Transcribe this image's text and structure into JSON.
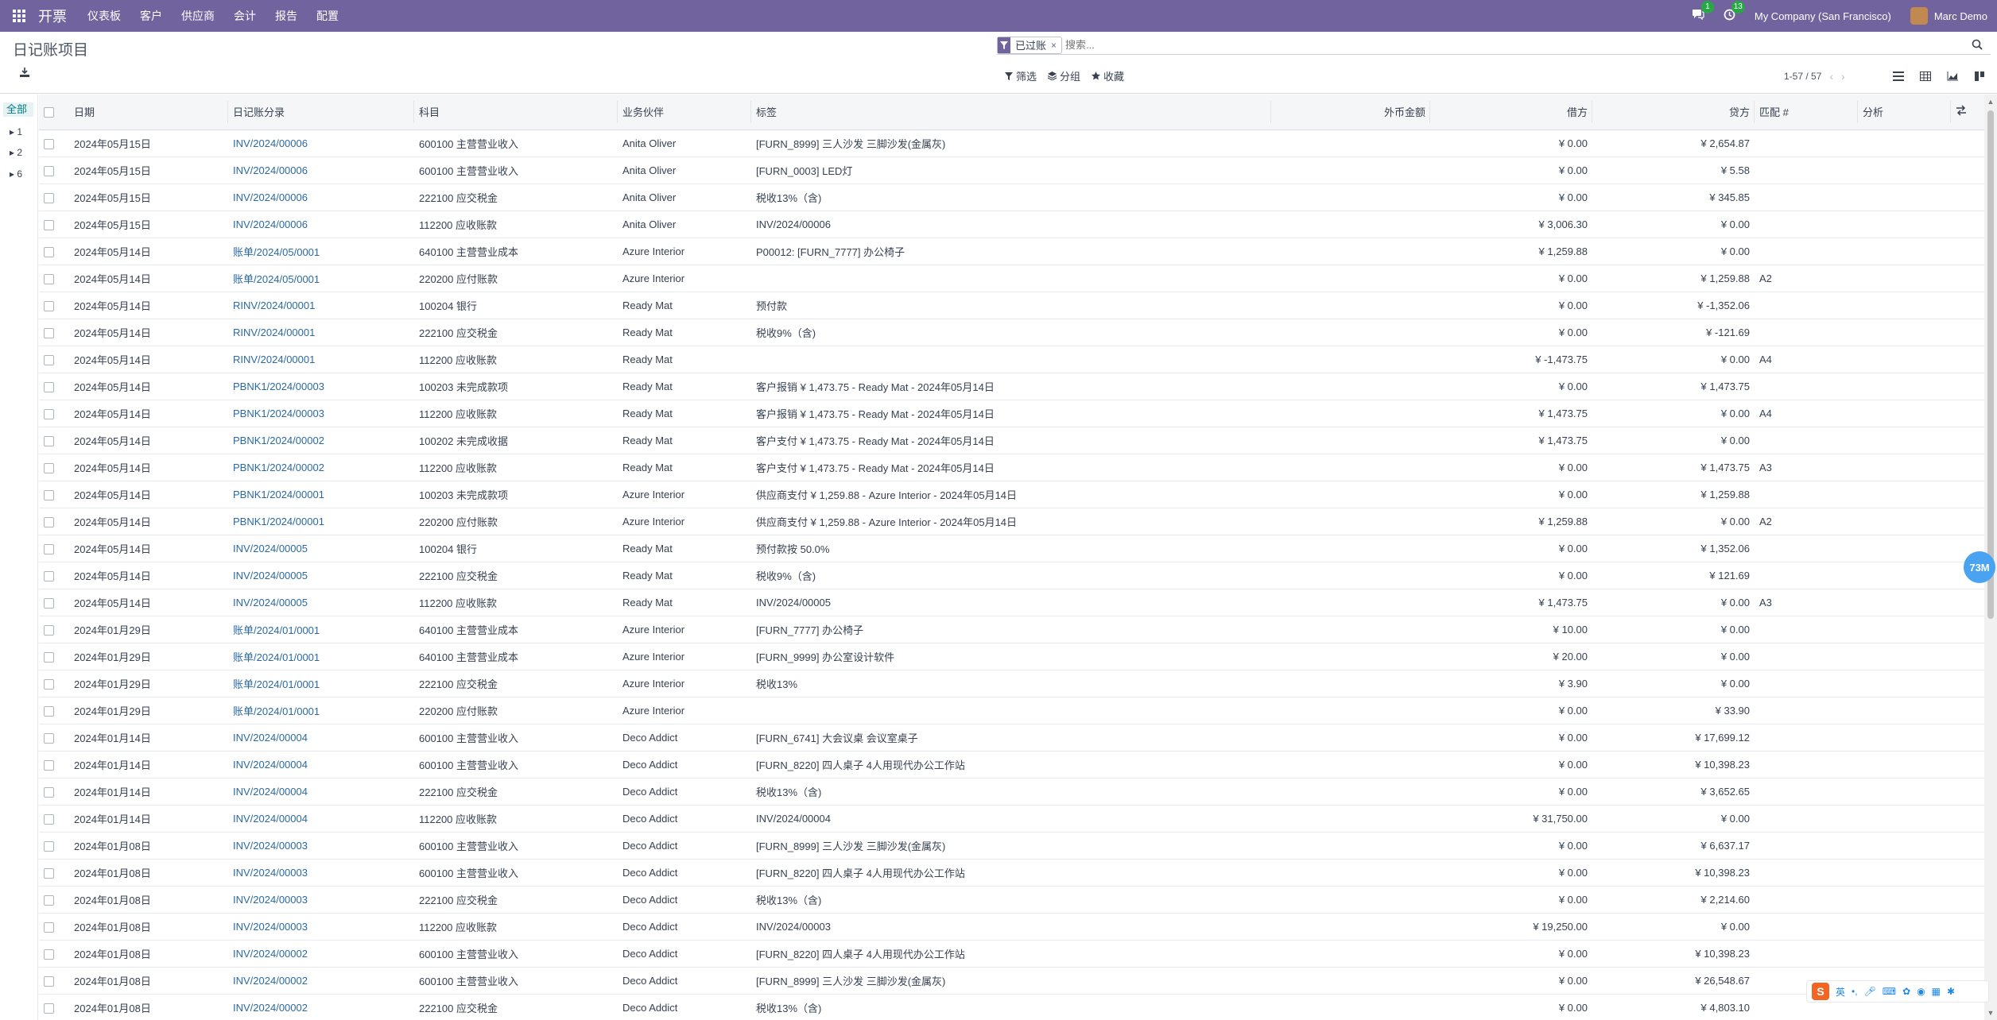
{
  "nav": {
    "app_name": "开票",
    "menus": [
      "仪表板",
      "客户",
      "供应商",
      "会计",
      "报告",
      "配置"
    ],
    "messages_badge": "1",
    "activity_badge": "13",
    "company": "My Company (San Francisco)",
    "user": "Marc Demo"
  },
  "control": {
    "title": "日记账项目",
    "facet_label": "已过账",
    "search_placeholder": "搜索...",
    "filter_label": "筛选",
    "group_label": "分组",
    "fav_label": "收藏",
    "pager": "1-57 / 57"
  },
  "side": {
    "all": "全部",
    "nodes": [
      "1",
      "2",
      "6"
    ]
  },
  "columns": {
    "date": "日期",
    "move": "日记账分录",
    "account": "科目",
    "partner": "业务伙伴",
    "label": "标签",
    "currency": "外币金额",
    "debit": "借方",
    "credit": "贷方",
    "matching": "匹配 #",
    "analytic": "分析"
  },
  "rows": [
    {
      "date": "2024年05月15日",
      "move": "INV/2024/00006",
      "account": "600100 主营营业收入",
      "partner": "Anita Oliver",
      "label": "[FURN_8999] 三人沙发 三脚沙发(金属灰)",
      "debit": "¥ 0.00",
      "credit": "¥ 2,654.87",
      "match": ""
    },
    {
      "date": "2024年05月15日",
      "move": "INV/2024/00006",
      "account": "600100 主营营业收入",
      "partner": "Anita Oliver",
      "label": "[FURN_0003] LED灯",
      "debit": "¥ 0.00",
      "credit": "¥ 5.58",
      "match": ""
    },
    {
      "date": "2024年05月15日",
      "move": "INV/2024/00006",
      "account": "222100 应交税金",
      "partner": "Anita Oliver",
      "label": "税收13%（含)",
      "debit": "¥ 0.00",
      "credit": "¥ 345.85",
      "match": ""
    },
    {
      "date": "2024年05月15日",
      "move": "INV/2024/00006",
      "account": "112200 应收账款",
      "partner": "Anita Oliver",
      "label": "INV/2024/00006",
      "debit": "¥ 3,006.30",
      "credit": "¥ 0.00",
      "match": ""
    },
    {
      "date": "2024年05月14日",
      "move": "账单/2024/05/0001",
      "account": "640100 主营营业成本",
      "partner": "Azure Interior",
      "label": "P00012: [FURN_7777] 办公椅子",
      "debit": "¥ 1,259.88",
      "credit": "¥ 0.00",
      "match": ""
    },
    {
      "date": "2024年05月14日",
      "move": "账单/2024/05/0001",
      "account": "220200 应付账款",
      "partner": "Azure Interior",
      "label": "",
      "debit": "¥ 0.00",
      "credit": "¥ 1,259.88",
      "match": "A2"
    },
    {
      "date": "2024年05月14日",
      "move": "RINV/2024/00001",
      "account": "100204 银行",
      "partner": "Ready Mat",
      "label": "预付款",
      "debit": "¥ 0.00",
      "credit": "¥ -1,352.06",
      "match": ""
    },
    {
      "date": "2024年05月14日",
      "move": "RINV/2024/00001",
      "account": "222100 应交税金",
      "partner": "Ready Mat",
      "label": "税收9%（含)",
      "debit": "¥ 0.00",
      "credit": "¥ -121.69",
      "match": ""
    },
    {
      "date": "2024年05月14日",
      "move": "RINV/2024/00001",
      "account": "112200 应收账款",
      "partner": "Ready Mat",
      "label": "",
      "debit": "¥ -1,473.75",
      "credit": "¥ 0.00",
      "match": "A4"
    },
    {
      "date": "2024年05月14日",
      "move": "PBNK1/2024/00003",
      "account": "100203 未完成款项",
      "partner": "Ready Mat",
      "label": "客户报销 ¥ 1,473.75 - Ready Mat - 2024年05月14日",
      "debit": "¥ 0.00",
      "credit": "¥ 1,473.75",
      "match": ""
    },
    {
      "date": "2024年05月14日",
      "move": "PBNK1/2024/00003",
      "account": "112200 应收账款",
      "partner": "Ready Mat",
      "label": "客户报销 ¥ 1,473.75 - Ready Mat - 2024年05月14日",
      "debit": "¥ 1,473.75",
      "credit": "¥ 0.00",
      "match": "A4"
    },
    {
      "date": "2024年05月14日",
      "move": "PBNK1/2024/00002",
      "account": "100202 未完成收据",
      "partner": "Ready Mat",
      "label": "客户支付 ¥ 1,473.75 - Ready Mat - 2024年05月14日",
      "debit": "¥ 1,473.75",
      "credit": "¥ 0.00",
      "match": ""
    },
    {
      "date": "2024年05月14日",
      "move": "PBNK1/2024/00002",
      "account": "112200 应收账款",
      "partner": "Ready Mat",
      "label": "客户支付 ¥ 1,473.75 - Ready Mat - 2024年05月14日",
      "debit": "¥ 0.00",
      "credit": "¥ 1,473.75",
      "match": "A3"
    },
    {
      "date": "2024年05月14日",
      "move": "PBNK1/2024/00001",
      "account": "100203 未完成款项",
      "partner": "Azure Interior",
      "label": "供应商支付 ¥ 1,259.88 - Azure Interior - 2024年05月14日",
      "debit": "¥ 0.00",
      "credit": "¥ 1,259.88",
      "match": ""
    },
    {
      "date": "2024年05月14日",
      "move": "PBNK1/2024/00001",
      "account": "220200 应付账款",
      "partner": "Azure Interior",
      "label": "供应商支付 ¥ 1,259.88 - Azure Interior - 2024年05月14日",
      "debit": "¥ 1,259.88",
      "credit": "¥ 0.00",
      "match": "A2"
    },
    {
      "date": "2024年05月14日",
      "move": "INV/2024/00005",
      "account": "100204 银行",
      "partner": "Ready Mat",
      "label": "预付款按 50.0%",
      "debit": "¥ 0.00",
      "credit": "¥ 1,352.06",
      "match": ""
    },
    {
      "date": "2024年05月14日",
      "move": "INV/2024/00005",
      "account": "222100 应交税金",
      "partner": "Ready Mat",
      "label": "税收9%（含)",
      "debit": "¥ 0.00",
      "credit": "¥ 121.69",
      "match": ""
    },
    {
      "date": "2024年05月14日",
      "move": "INV/2024/00005",
      "account": "112200 应收账款",
      "partner": "Ready Mat",
      "label": "INV/2024/00005",
      "debit": "¥ 1,473.75",
      "credit": "¥ 0.00",
      "match": "A3"
    },
    {
      "date": "2024年01月29日",
      "move": "账单/2024/01/0001",
      "account": "640100 主营营业成本",
      "partner": "Azure Interior",
      "label": "[FURN_7777] 办公椅子",
      "debit": "¥ 10.00",
      "credit": "¥ 0.00",
      "match": ""
    },
    {
      "date": "2024年01月29日",
      "move": "账单/2024/01/0001",
      "account": "640100 主营营业成本",
      "partner": "Azure Interior",
      "label": "[FURN_9999] 办公室设计软件",
      "debit": "¥ 20.00",
      "credit": "¥ 0.00",
      "match": ""
    },
    {
      "date": "2024年01月29日",
      "move": "账单/2024/01/0001",
      "account": "222100 应交税金",
      "partner": "Azure Interior",
      "label": "税收13%",
      "debit": "¥ 3.90",
      "credit": "¥ 0.00",
      "match": ""
    },
    {
      "date": "2024年01月29日",
      "move": "账单/2024/01/0001",
      "account": "220200 应付账款",
      "partner": "Azure Interior",
      "label": "",
      "debit": "¥ 0.00",
      "credit": "¥ 33.90",
      "match": ""
    },
    {
      "date": "2024年01月14日",
      "move": "INV/2024/00004",
      "account": "600100 主营营业收入",
      "partner": "Deco Addict",
      "label": "[FURN_6741] 大会议桌 会议室桌子",
      "debit": "¥ 0.00",
      "credit": "¥ 17,699.12",
      "match": ""
    },
    {
      "date": "2024年01月14日",
      "move": "INV/2024/00004",
      "account": "600100 主营营业收入",
      "partner": "Deco Addict",
      "label": "[FURN_8220] 四人桌子 4人用现代办公工作站",
      "debit": "¥ 0.00",
      "credit": "¥ 10,398.23",
      "match": ""
    },
    {
      "date": "2024年01月14日",
      "move": "INV/2024/00004",
      "account": "222100 应交税金",
      "partner": "Deco Addict",
      "label": "税收13%（含)",
      "debit": "¥ 0.00",
      "credit": "¥ 3,652.65",
      "match": ""
    },
    {
      "date": "2024年01月14日",
      "move": "INV/2024/00004",
      "account": "112200 应收账款",
      "partner": "Deco Addict",
      "label": "INV/2024/00004",
      "debit": "¥ 31,750.00",
      "credit": "¥ 0.00",
      "match": ""
    },
    {
      "date": "2024年01月08日",
      "move": "INV/2024/00003",
      "account": "600100 主营营业收入",
      "partner": "Deco Addict",
      "label": "[FURN_8999] 三人沙发 三脚沙发(金属灰)",
      "debit": "¥ 0.00",
      "credit": "¥ 6,637.17",
      "match": ""
    },
    {
      "date": "2024年01月08日",
      "move": "INV/2024/00003",
      "account": "600100 主营营业收入",
      "partner": "Deco Addict",
      "label": "[FURN_8220] 四人桌子 4人用现代办公工作站",
      "debit": "¥ 0.00",
      "credit": "¥ 10,398.23",
      "match": ""
    },
    {
      "date": "2024年01月08日",
      "move": "INV/2024/00003",
      "account": "222100 应交税金",
      "partner": "Deco Addict",
      "label": "税收13%（含)",
      "debit": "¥ 0.00",
      "credit": "¥ 2,214.60",
      "match": ""
    },
    {
      "date": "2024年01月08日",
      "move": "INV/2024/00003",
      "account": "112200 应收账款",
      "partner": "Deco Addict",
      "label": "INV/2024/00003",
      "debit": "¥ 19,250.00",
      "credit": "¥ 0.00",
      "match": ""
    },
    {
      "date": "2024年01月08日",
      "move": "INV/2024/00002",
      "account": "600100 主营营业收入",
      "partner": "Deco Addict",
      "label": "[FURN_8220] 四人桌子 4人用现代办公工作站",
      "debit": "¥ 0.00",
      "credit": "¥ 10,398.23",
      "match": ""
    },
    {
      "date": "2024年01月08日",
      "move": "INV/2024/00002",
      "account": "600100 主营营业收入",
      "partner": "Deco Addict",
      "label": "[FURN_8999] 三人沙发 三脚沙发(金属灰)",
      "debit": "¥ 0.00",
      "credit": "¥ 26,548.67",
      "match": ""
    },
    {
      "date": "2024年01月08日",
      "move": "INV/2024/00002",
      "account": "222100 应交税金",
      "partner": "Deco Addict",
      "label": "税收13%（含)",
      "debit": "¥ 0.00",
      "credit": "¥ 4,803.10",
      "match": ""
    }
  ],
  "float_badge": "73M",
  "ime": {
    "lang": "英"
  },
  "colors": {
    "brand": "#71639e",
    "link": "#2a6aa3",
    "badge": "#28a745"
  },
  "icons": [
    "apps-grid-icon",
    "chat-icon",
    "clock-icon",
    "download-icon",
    "filter-icon",
    "layers-icon",
    "star-icon",
    "search-icon",
    "list-view-icon",
    "pivot-view-icon",
    "graph-view-icon",
    "kanban-view-icon",
    "optional-columns-icon"
  ]
}
